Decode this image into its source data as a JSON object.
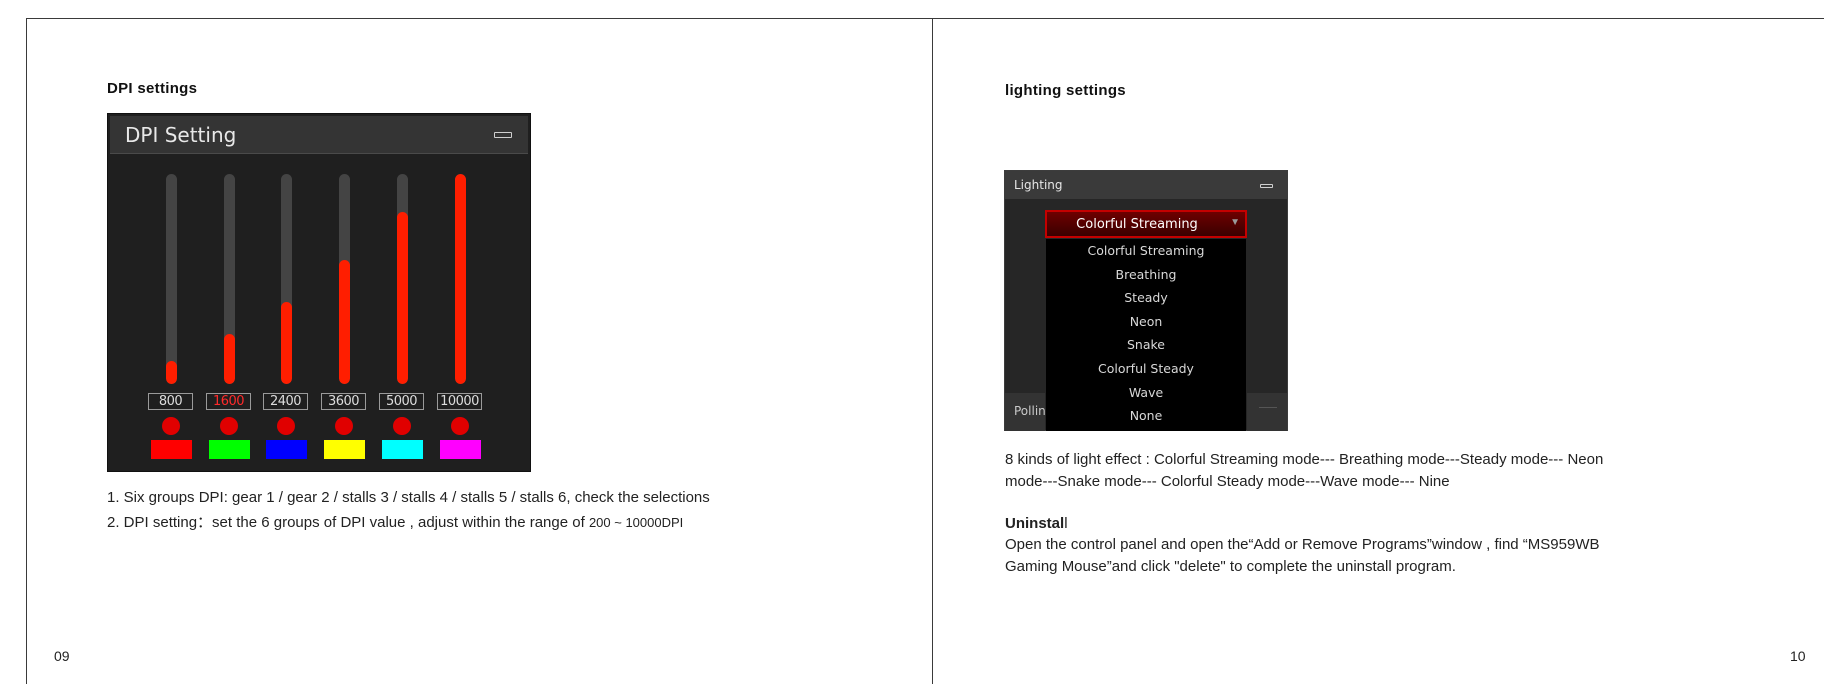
{
  "left_page": {
    "heading": "DPI settings",
    "widget": {
      "title": "DPI Setting",
      "sliders": [
        {
          "value": "800",
          "fill_fraction": 0.11,
          "active": false,
          "swatch_color": "#ff0000"
        },
        {
          "value": "1600",
          "fill_fraction": 0.24,
          "active": true,
          "swatch_color": "#00ff00"
        },
        {
          "value": "2400",
          "fill_fraction": 0.39,
          "active": false,
          "swatch_color": "#0000ff"
        },
        {
          "value": "3600",
          "fill_fraction": 0.59,
          "active": false,
          "swatch_color": "#ffff00"
        },
        {
          "value": "5000",
          "fill_fraction": 0.82,
          "active": false,
          "swatch_color": "#00ffff"
        },
        {
          "value": "10000",
          "fill_fraction": 1.0,
          "active": false,
          "swatch_color": "#ff00ff"
        }
      ]
    },
    "line1": "1. Six groups DPI: gear 1 / gear 2 / stalls 3 / stalls 4 / stalls 5 / stalls 6, check the selections",
    "line2_main": "2. DPI setting：set the 6 groups of DPI value , adjust within the range of ",
    "line2_range": "200 ~ 10000DPI",
    "page_number": "09"
  },
  "right_page": {
    "heading": "lighting settings",
    "widget": {
      "title": "Lighting",
      "selected": "Colorful Streaming",
      "options": [
        "Colorful Streaming",
        "Breathing",
        "Steady",
        "Neon",
        "Snake",
        "Colorful Steady",
        "Wave",
        "None"
      ],
      "partial_label": "Pollin"
    },
    "effects_line1": "8 kinds of light effect : Colorful Streaming mode--- Breathing mode---Steady mode--- Neon",
    "effects_line2": "mode---Snake mode--- Colorful Steady mode---Wave mode--- Nine",
    "uninstall_heading_bold": "Uninstal",
    "uninstall_heading_rest": "l",
    "uninstall_line1": "Open the control panel and open the“Add or Remove Programs”window , find “MS959WB",
    "uninstall_line2": "Gaming Mouse”and click \"delete\" to complete the uninstall program.",
    "page_number": "10"
  }
}
